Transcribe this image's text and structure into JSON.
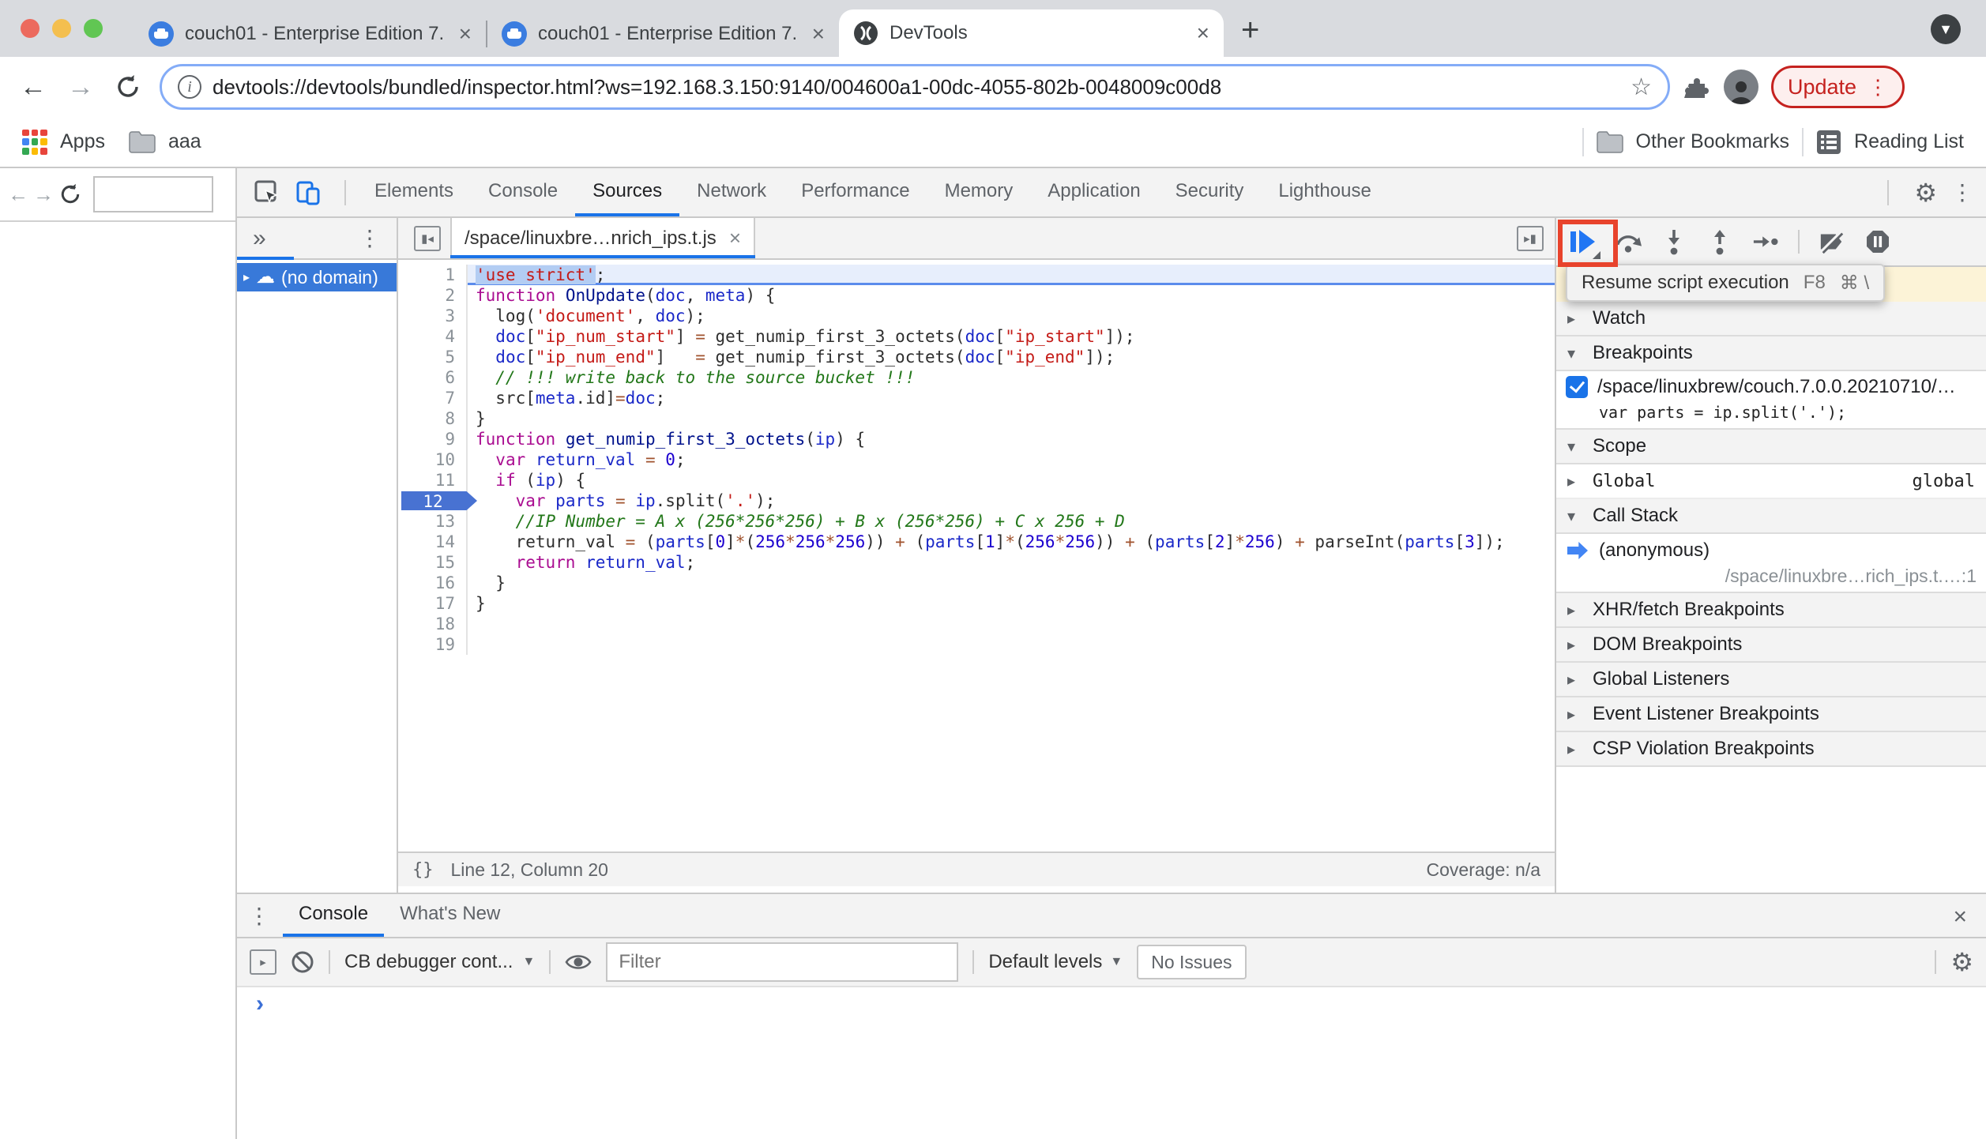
{
  "browser": {
    "tabs": [
      {
        "title": "couch01 - Enterprise Edition 7."
      },
      {
        "title": "couch01 - Enterprise Edition 7."
      },
      {
        "title": "DevTools"
      }
    ],
    "close_glyph": "×",
    "new_tab_glyph": "+",
    "toolbar": {
      "back_glyph": "←",
      "forward_glyph": "→",
      "url": "devtools://devtools/bundled/inspector.html?ws=192.168.3.150:9140/004600a1-00dc-4055-802b-0048009c00d8",
      "star_glyph": "☆",
      "update_label": "Update"
    },
    "bookmarks_bar": {
      "apps_label": "Apps",
      "folder_label": "aaa",
      "other_bookmarks_label": "Other Bookmarks",
      "reading_list_label": "Reading List"
    }
  },
  "devtools": {
    "panel_tabs": [
      "Elements",
      "Console",
      "Sources",
      "Network",
      "Performance",
      "Memory",
      "Application",
      "Security",
      "Lighthouse"
    ],
    "active_panel": "Sources",
    "gear_glyph": "⚙",
    "menu_glyph": "⋮"
  },
  "sources": {
    "navigator": {
      "more_tabs_glyph": "»",
      "item_label": "(no domain)",
      "cloud_glyph": "☁",
      "expand_glyph": "▸"
    },
    "file_tab": "/space/linuxbre…nrich_ips.t.js",
    "paused_line": 12,
    "status_bar": {
      "braces_glyph": "{}",
      "position": "Line 12, Column 20",
      "coverage": "Coverage: n/a"
    },
    "code_lines": [
      {
        "n": 1,
        "t": [
          [
            "ssel",
            "'use strict'"
          ],
          [
            "p",
            ";"
          ]
        ]
      },
      {
        "n": 2,
        "t": [
          [
            "k",
            "function"
          ],
          [
            "p",
            " "
          ],
          [
            "d",
            "OnUpdate"
          ],
          [
            "p",
            "("
          ],
          [
            "v",
            "doc"
          ],
          [
            "p",
            ", "
          ],
          [
            "v",
            "meta"
          ],
          [
            "p",
            ") {"
          ]
        ]
      },
      {
        "n": 3,
        "t": [
          [
            "p",
            "  log("
          ],
          [
            "s",
            "'document'"
          ],
          [
            "p",
            ", "
          ],
          [
            "v",
            "doc"
          ],
          [
            "p",
            ");"
          ]
        ]
      },
      {
        "n": 4,
        "t": [
          [
            "p",
            "  "
          ],
          [
            "v",
            "doc"
          ],
          [
            "p",
            "["
          ],
          [
            "s",
            "\"ip_num_start\""
          ],
          [
            "p",
            "] "
          ],
          [
            "o",
            "="
          ],
          [
            "p",
            " get_numip_first_3_octets("
          ],
          [
            "v",
            "doc"
          ],
          [
            "p",
            "["
          ],
          [
            "s",
            "\"ip_start\""
          ],
          [
            "p",
            "]);"
          ]
        ]
      },
      {
        "n": 5,
        "t": [
          [
            "p",
            "  "
          ],
          [
            "v",
            "doc"
          ],
          [
            "p",
            "["
          ],
          [
            "s",
            "\"ip_num_end\""
          ],
          [
            "p",
            "]   "
          ],
          [
            "o",
            "="
          ],
          [
            "p",
            " get_numip_first_3_octets("
          ],
          [
            "v",
            "doc"
          ],
          [
            "p",
            "["
          ],
          [
            "s",
            "\"ip_end\""
          ],
          [
            "p",
            "]);"
          ]
        ]
      },
      {
        "n": 6,
        "t": [
          [
            "c",
            "  // !!! write back to the source bucket !!!"
          ]
        ]
      },
      {
        "n": 7,
        "t": [
          [
            "p",
            "  src["
          ],
          [
            "v",
            "meta"
          ],
          [
            "p",
            ".id]"
          ],
          [
            "o",
            "="
          ],
          [
            "v",
            "doc"
          ],
          [
            "p",
            ";"
          ]
        ]
      },
      {
        "n": 8,
        "t": [
          [
            "p",
            "}"
          ]
        ]
      },
      {
        "n": 9,
        "t": [
          [
            "k",
            "function"
          ],
          [
            "p",
            " "
          ],
          [
            "d",
            "get_numip_first_3_octets"
          ],
          [
            "p",
            "("
          ],
          [
            "v",
            "ip"
          ],
          [
            "p",
            ") {"
          ]
        ]
      },
      {
        "n": 10,
        "t": [
          [
            "p",
            "  "
          ],
          [
            "k",
            "var"
          ],
          [
            "p",
            " "
          ],
          [
            "v",
            "return_val"
          ],
          [
            "p",
            " "
          ],
          [
            "o",
            "="
          ],
          [
            "p",
            " "
          ],
          [
            "num",
            "0"
          ],
          [
            "p",
            ";"
          ]
        ]
      },
      {
        "n": 11,
        "t": [
          [
            "p",
            "  "
          ],
          [
            "k",
            "if"
          ],
          [
            "p",
            " ("
          ],
          [
            "v",
            "ip"
          ],
          [
            "p",
            ") {"
          ]
        ]
      },
      {
        "n": 12,
        "t": [
          [
            "p",
            "    "
          ],
          [
            "k",
            "var"
          ],
          [
            "p",
            " "
          ],
          [
            "v",
            "parts"
          ],
          [
            "p",
            " "
          ],
          [
            "o",
            "="
          ],
          [
            "p",
            " "
          ],
          [
            "v",
            "ip"
          ],
          [
            "p",
            ".split("
          ],
          [
            "s",
            "'.'"
          ],
          [
            "p",
            ");"
          ]
        ]
      },
      {
        "n": 13,
        "t": [
          [
            "c",
            "    //IP Number = A x (256*256*256) + B x (256*256) + C x 256 + D"
          ]
        ]
      },
      {
        "n": 14,
        "t": [
          [
            "p",
            "    return_val "
          ],
          [
            "o",
            "="
          ],
          [
            "p",
            " ("
          ],
          [
            "v",
            "parts"
          ],
          [
            "p",
            "["
          ],
          [
            "num",
            "0"
          ],
          [
            "p",
            "]"
          ],
          [
            "o",
            "*"
          ],
          [
            "p",
            "("
          ],
          [
            "num",
            "256"
          ],
          [
            "o",
            "*"
          ],
          [
            "num",
            "256"
          ],
          [
            "o",
            "*"
          ],
          [
            "num",
            "256"
          ],
          [
            "p",
            ")) "
          ],
          [
            "o",
            "+"
          ],
          [
            "p",
            " ("
          ],
          [
            "v",
            "parts"
          ],
          [
            "p",
            "["
          ],
          [
            "num",
            "1"
          ],
          [
            "p",
            "]"
          ],
          [
            "o",
            "*"
          ],
          [
            "p",
            "("
          ],
          [
            "num",
            "256"
          ],
          [
            "o",
            "*"
          ],
          [
            "num",
            "256"
          ],
          [
            "p",
            ")) "
          ],
          [
            "o",
            "+"
          ],
          [
            "p",
            " ("
          ],
          [
            "v",
            "parts"
          ],
          [
            "p",
            "["
          ],
          [
            "num",
            "2"
          ],
          [
            "p",
            "]"
          ],
          [
            "o",
            "*"
          ],
          [
            "num",
            "256"
          ],
          [
            "p",
            ") "
          ],
          [
            "o",
            "+"
          ],
          [
            "p",
            " parseInt("
          ],
          [
            "v",
            "parts"
          ],
          [
            "p",
            "["
          ],
          [
            "num",
            "3"
          ],
          [
            "p",
            "]);"
          ]
        ]
      },
      {
        "n": 15,
        "t": [
          [
            "p",
            "    "
          ],
          [
            "k",
            "return"
          ],
          [
            "p",
            " "
          ],
          [
            "v",
            "return_val"
          ],
          [
            "p",
            ";"
          ]
        ]
      },
      {
        "n": 16,
        "t": [
          [
            "p",
            "  }"
          ]
        ]
      },
      {
        "n": 17,
        "t": [
          [
            "p",
            "}"
          ]
        ]
      },
      {
        "n": 18,
        "t": []
      },
      {
        "n": 19,
        "t": []
      }
    ]
  },
  "debugger_sidebar": {
    "tooltip": {
      "label": "Resume script execution",
      "shortcut1": "F8",
      "shortcut2": "⌘ \\"
    },
    "watch_label": "Watch",
    "breakpoints_label": "Breakpoints",
    "breakpoint": {
      "path": "/space/linuxbrew/couch.7.0.0.20210710/…",
      "snippet": "var parts = ip.split('.');"
    },
    "scope_label": "Scope",
    "scope_rows": [
      {
        "label": "Global",
        "value": "global"
      }
    ],
    "callstack_label": "Call Stack",
    "frames": [
      {
        "name": "(anonymous)",
        "location": "/space/linuxbre…rich_ips.t.…:1"
      }
    ],
    "collapsed_sections": [
      "XHR/fetch Breakpoints",
      "DOM Breakpoints",
      "Global Listeners",
      "Event Listener Breakpoints",
      "CSP Violation Breakpoints"
    ],
    "collapsed_glyph": "▸",
    "expanded_glyph": "▾"
  },
  "console_drawer": {
    "tabs": [
      "Console",
      "What's New"
    ],
    "active_tab": "Console",
    "menu_glyph": "⋮",
    "context_selector": "CB debugger cont...",
    "filter_placeholder": "Filter",
    "levels_label": "Default levels",
    "no_issues_label": "No Issues",
    "close_glyph": "×",
    "prompt_glyph": "›"
  }
}
